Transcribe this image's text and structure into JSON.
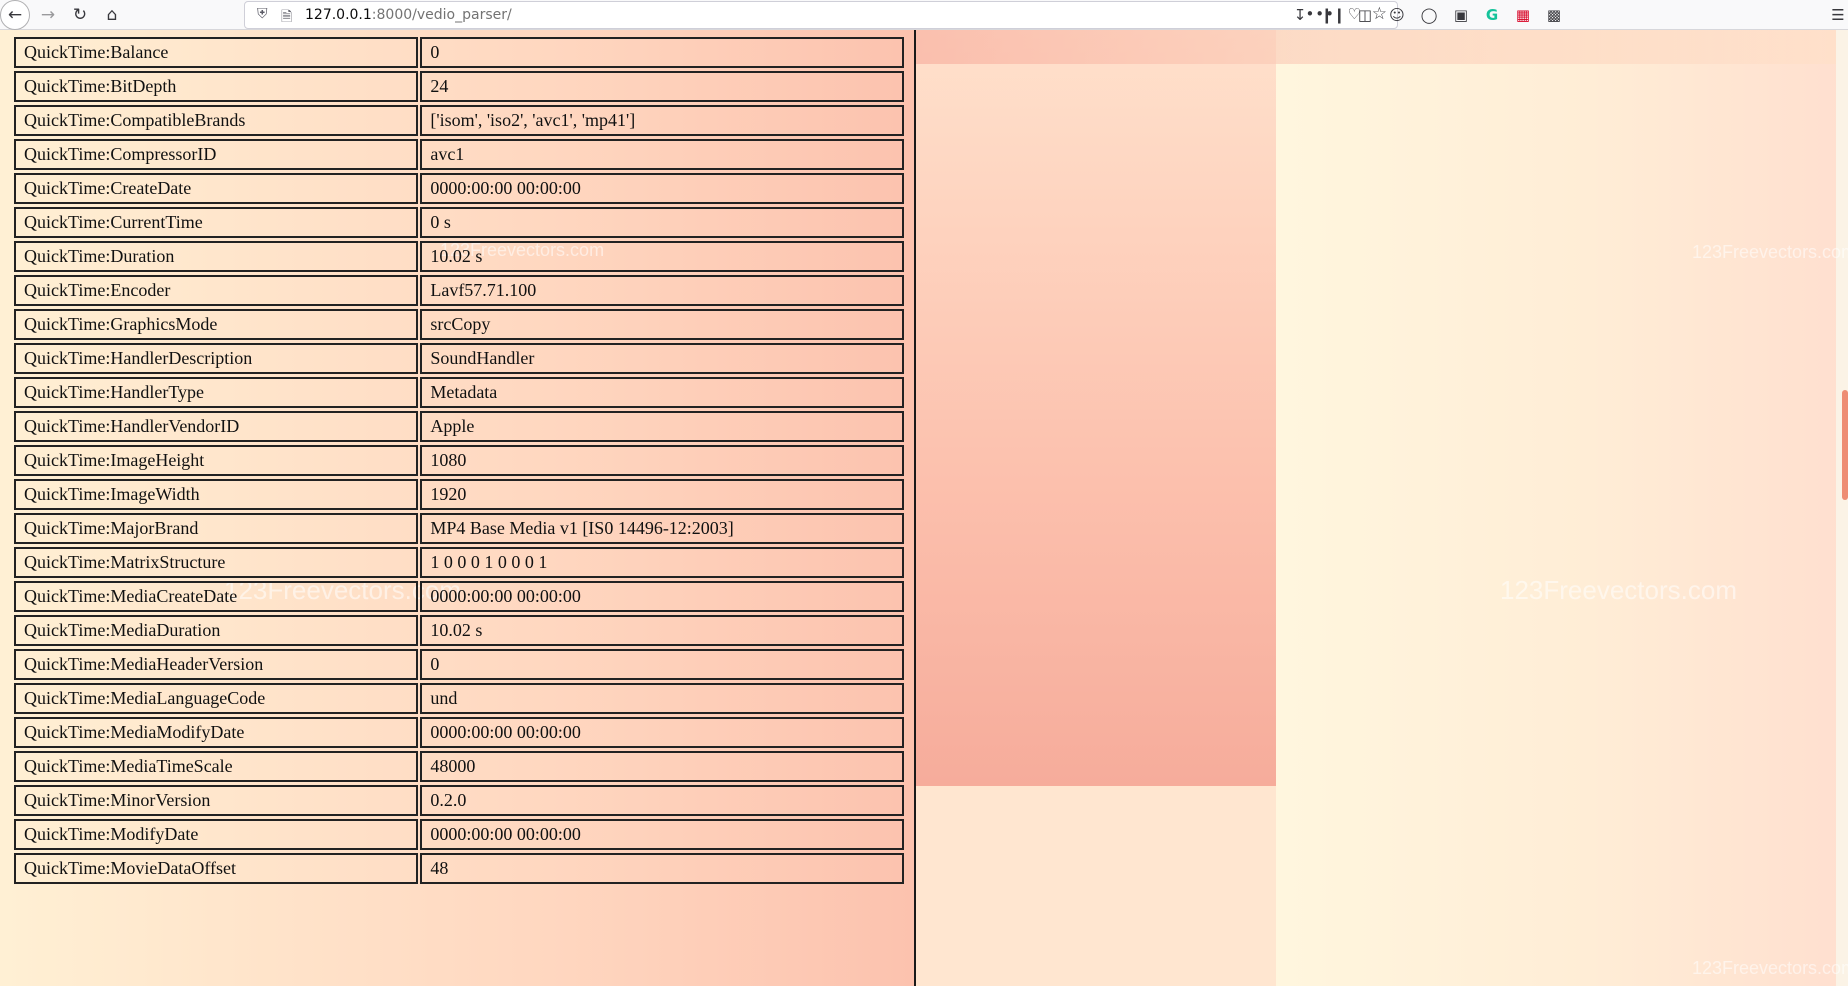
{
  "browser": {
    "url_host": "127.0.0.1",
    "url_rest": ":8000/vedio_parser/",
    "icons": {
      "back": "back-arrow-icon",
      "forward": "forward-arrow-icon",
      "reload": "reload-icon",
      "home": "home-icon",
      "shield": "tracking-shield-icon",
      "page": "page-info-icon",
      "more": "more-actions-icon",
      "pocket": "pocket-icon",
      "bookmark": "bookmark-star-icon",
      "download": "download-icon",
      "library": "library-icon",
      "sidebar": "sidebar-icon",
      "account": "account-icon",
      "extension_globe": "globe-extension-icon",
      "extension_screenshot": "screenshot-extension-icon",
      "extension_grammarly": "grammarly-icon",
      "extension_pdf": "pdf-icon",
      "extension_window": "window-icon",
      "menu": "hamburger-menu-icon"
    }
  },
  "background": {
    "watermark": "123Freevectors.com",
    "accent": "#ee8d74"
  },
  "rows": [
    {
      "key": "QuickTime:Balance",
      "value": "0"
    },
    {
      "key": "QuickTime:BitDepth",
      "value": "24"
    },
    {
      "key": "QuickTime:CompatibleBrands",
      "value": "['isom', 'iso2', 'avc1', 'mp41']"
    },
    {
      "key": "QuickTime:CompressorID",
      "value": "avc1"
    },
    {
      "key": "QuickTime:CreateDate",
      "value": "0000:00:00 00:00:00"
    },
    {
      "key": "QuickTime:CurrentTime",
      "value": "0 s"
    },
    {
      "key": "QuickTime:Duration",
      "value": "10.02 s"
    },
    {
      "key": "QuickTime:Encoder",
      "value": "Lavf57.71.100"
    },
    {
      "key": "QuickTime:GraphicsMode",
      "value": "srcCopy"
    },
    {
      "key": "QuickTime:HandlerDescription",
      "value": "SoundHandler"
    },
    {
      "key": "QuickTime:HandlerType",
      "value": "Metadata"
    },
    {
      "key": "QuickTime:HandlerVendorID",
      "value": "Apple"
    },
    {
      "key": "QuickTime:ImageHeight",
      "value": "1080"
    },
    {
      "key": "QuickTime:ImageWidth",
      "value": "1920"
    },
    {
      "key": "QuickTime:MajorBrand",
      "value": "MP4 Base Media v1 [IS0 14496-12:2003]"
    },
    {
      "key": "QuickTime:MatrixStructure",
      "value": "1 0 0 0 1 0 0 0 1"
    },
    {
      "key": "QuickTime:MediaCreateDate",
      "value": "0000:00:00 00:00:00"
    },
    {
      "key": "QuickTime:MediaDuration",
      "value": "10.02 s"
    },
    {
      "key": "QuickTime:MediaHeaderVersion",
      "value": "0"
    },
    {
      "key": "QuickTime:MediaLanguageCode",
      "value": "und"
    },
    {
      "key": "QuickTime:MediaModifyDate",
      "value": "0000:00:00 00:00:00"
    },
    {
      "key": "QuickTime:MediaTimeScale",
      "value": "48000"
    },
    {
      "key": "QuickTime:MinorVersion",
      "value": "0.2.0"
    },
    {
      "key": "QuickTime:ModifyDate",
      "value": "0000:00:00 00:00:00"
    },
    {
      "key": "QuickTime:MovieDataOffset",
      "value": "48"
    }
  ]
}
